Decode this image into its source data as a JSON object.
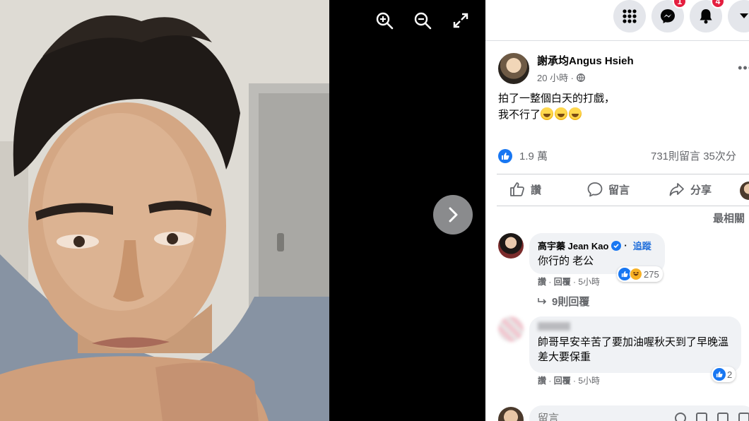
{
  "viewer": {
    "tools": [
      {
        "name": "zoom-in-icon"
      },
      {
        "name": "zoom-out-icon"
      },
      {
        "name": "fullscreen-icon"
      }
    ],
    "next_icon": "chevron-right-icon"
  },
  "topbar": {
    "messenger_badge": "1",
    "notifications_badge": "4"
  },
  "post": {
    "author": "謝承均Angus Hsieh",
    "time": "20 小時 ·",
    "text_line1": "拍了一整個白天的打戲，",
    "text_line2": "我不行了",
    "reactions": "1.9 萬",
    "comments_shares": "731則留言  35次分",
    "actions": {
      "like": "讚",
      "comment": "留言",
      "share": "分享"
    },
    "sort_label": "最相關"
  },
  "comments": [
    {
      "name": "高宇蓁 Jean Kao",
      "follow": "追蹤",
      "text": "你行的 老公",
      "reaction_count": "275",
      "like": "讚",
      "reply": "回覆",
      "time": "5小時",
      "replies": "9則回覆"
    },
    {
      "name": "",
      "text": "帥哥早安辛苦了要加油喔秋天到了早晚溫差大要保重",
      "reaction_count": "2",
      "like": "讚",
      "reply": "回覆",
      "time": "5小時"
    }
  ],
  "composer": {
    "placeholder": "留言"
  },
  "colors": {
    "accent": "#1877f2",
    "badge": "#e41e3f",
    "secondary_text": "#65676b",
    "bubble": "#f0f2f5"
  }
}
